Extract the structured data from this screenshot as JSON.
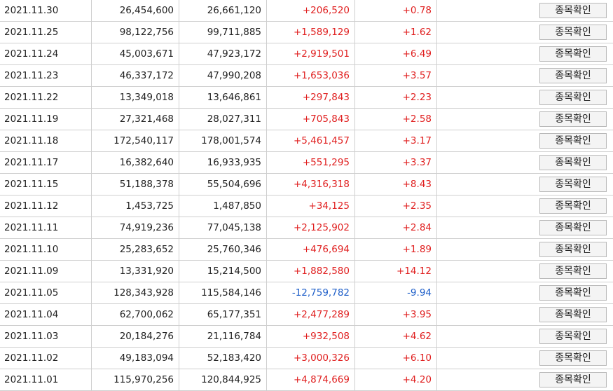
{
  "button_label": "종목확인",
  "colors": {
    "up": "#e02020",
    "down": "#1f5fc9"
  },
  "rows": [
    {
      "date": "2021.11.30",
      "v1": "26,454,600",
      "v2": "26,661,120",
      "change": "+206,520",
      "pct": "+0.78",
      "dir": "up"
    },
    {
      "date": "2021.11.25",
      "v1": "98,122,756",
      "v2": "99,711,885",
      "change": "+1,589,129",
      "pct": "+1.62",
      "dir": "up"
    },
    {
      "date": "2021.11.24",
      "v1": "45,003,671",
      "v2": "47,923,172",
      "change": "+2,919,501",
      "pct": "+6.49",
      "dir": "up"
    },
    {
      "date": "2021.11.23",
      "v1": "46,337,172",
      "v2": "47,990,208",
      "change": "+1,653,036",
      "pct": "+3.57",
      "dir": "up"
    },
    {
      "date": "2021.11.22",
      "v1": "13,349,018",
      "v2": "13,646,861",
      "change": "+297,843",
      "pct": "+2.23",
      "dir": "up"
    },
    {
      "date": "2021.11.19",
      "v1": "27,321,468",
      "v2": "28,027,311",
      "change": "+705,843",
      "pct": "+2.58",
      "dir": "up"
    },
    {
      "date": "2021.11.18",
      "v1": "172,540,117",
      "v2": "178,001,574",
      "change": "+5,461,457",
      "pct": "+3.17",
      "dir": "up"
    },
    {
      "date": "2021.11.17",
      "v1": "16,382,640",
      "v2": "16,933,935",
      "change": "+551,295",
      "pct": "+3.37",
      "dir": "up"
    },
    {
      "date": "2021.11.15",
      "v1": "51,188,378",
      "v2": "55,504,696",
      "change": "+4,316,318",
      "pct": "+8.43",
      "dir": "up"
    },
    {
      "date": "2021.11.12",
      "v1": "1,453,725",
      "v2": "1,487,850",
      "change": "+34,125",
      "pct": "+2.35",
      "dir": "up"
    },
    {
      "date": "2021.11.11",
      "v1": "74,919,236",
      "v2": "77,045,138",
      "change": "+2,125,902",
      "pct": "+2.84",
      "dir": "up"
    },
    {
      "date": "2021.11.10",
      "v1": "25,283,652",
      "v2": "25,760,346",
      "change": "+476,694",
      "pct": "+1.89",
      "dir": "up"
    },
    {
      "date": "2021.11.09",
      "v1": "13,331,920",
      "v2": "15,214,500",
      "change": "+1,882,580",
      "pct": "+14.12",
      "dir": "up"
    },
    {
      "date": "2021.11.05",
      "v1": "128,343,928",
      "v2": "115,584,146",
      "change": "-12,759,782",
      "pct": "-9.94",
      "dir": "down"
    },
    {
      "date": "2021.11.04",
      "v1": "62,700,062",
      "v2": "65,177,351",
      "change": "+2,477,289",
      "pct": "+3.95",
      "dir": "up"
    },
    {
      "date": "2021.11.03",
      "v1": "20,184,276",
      "v2": "21,116,784",
      "change": "+932,508",
      "pct": "+4.62",
      "dir": "up"
    },
    {
      "date": "2021.11.02",
      "v1": "49,183,094",
      "v2": "52,183,420",
      "change": "+3,000,326",
      "pct": "+6.10",
      "dir": "up"
    },
    {
      "date": "2021.11.01",
      "v1": "115,970,256",
      "v2": "120,844,925",
      "change": "+4,874,669",
      "pct": "+4.20",
      "dir": "up"
    }
  ]
}
